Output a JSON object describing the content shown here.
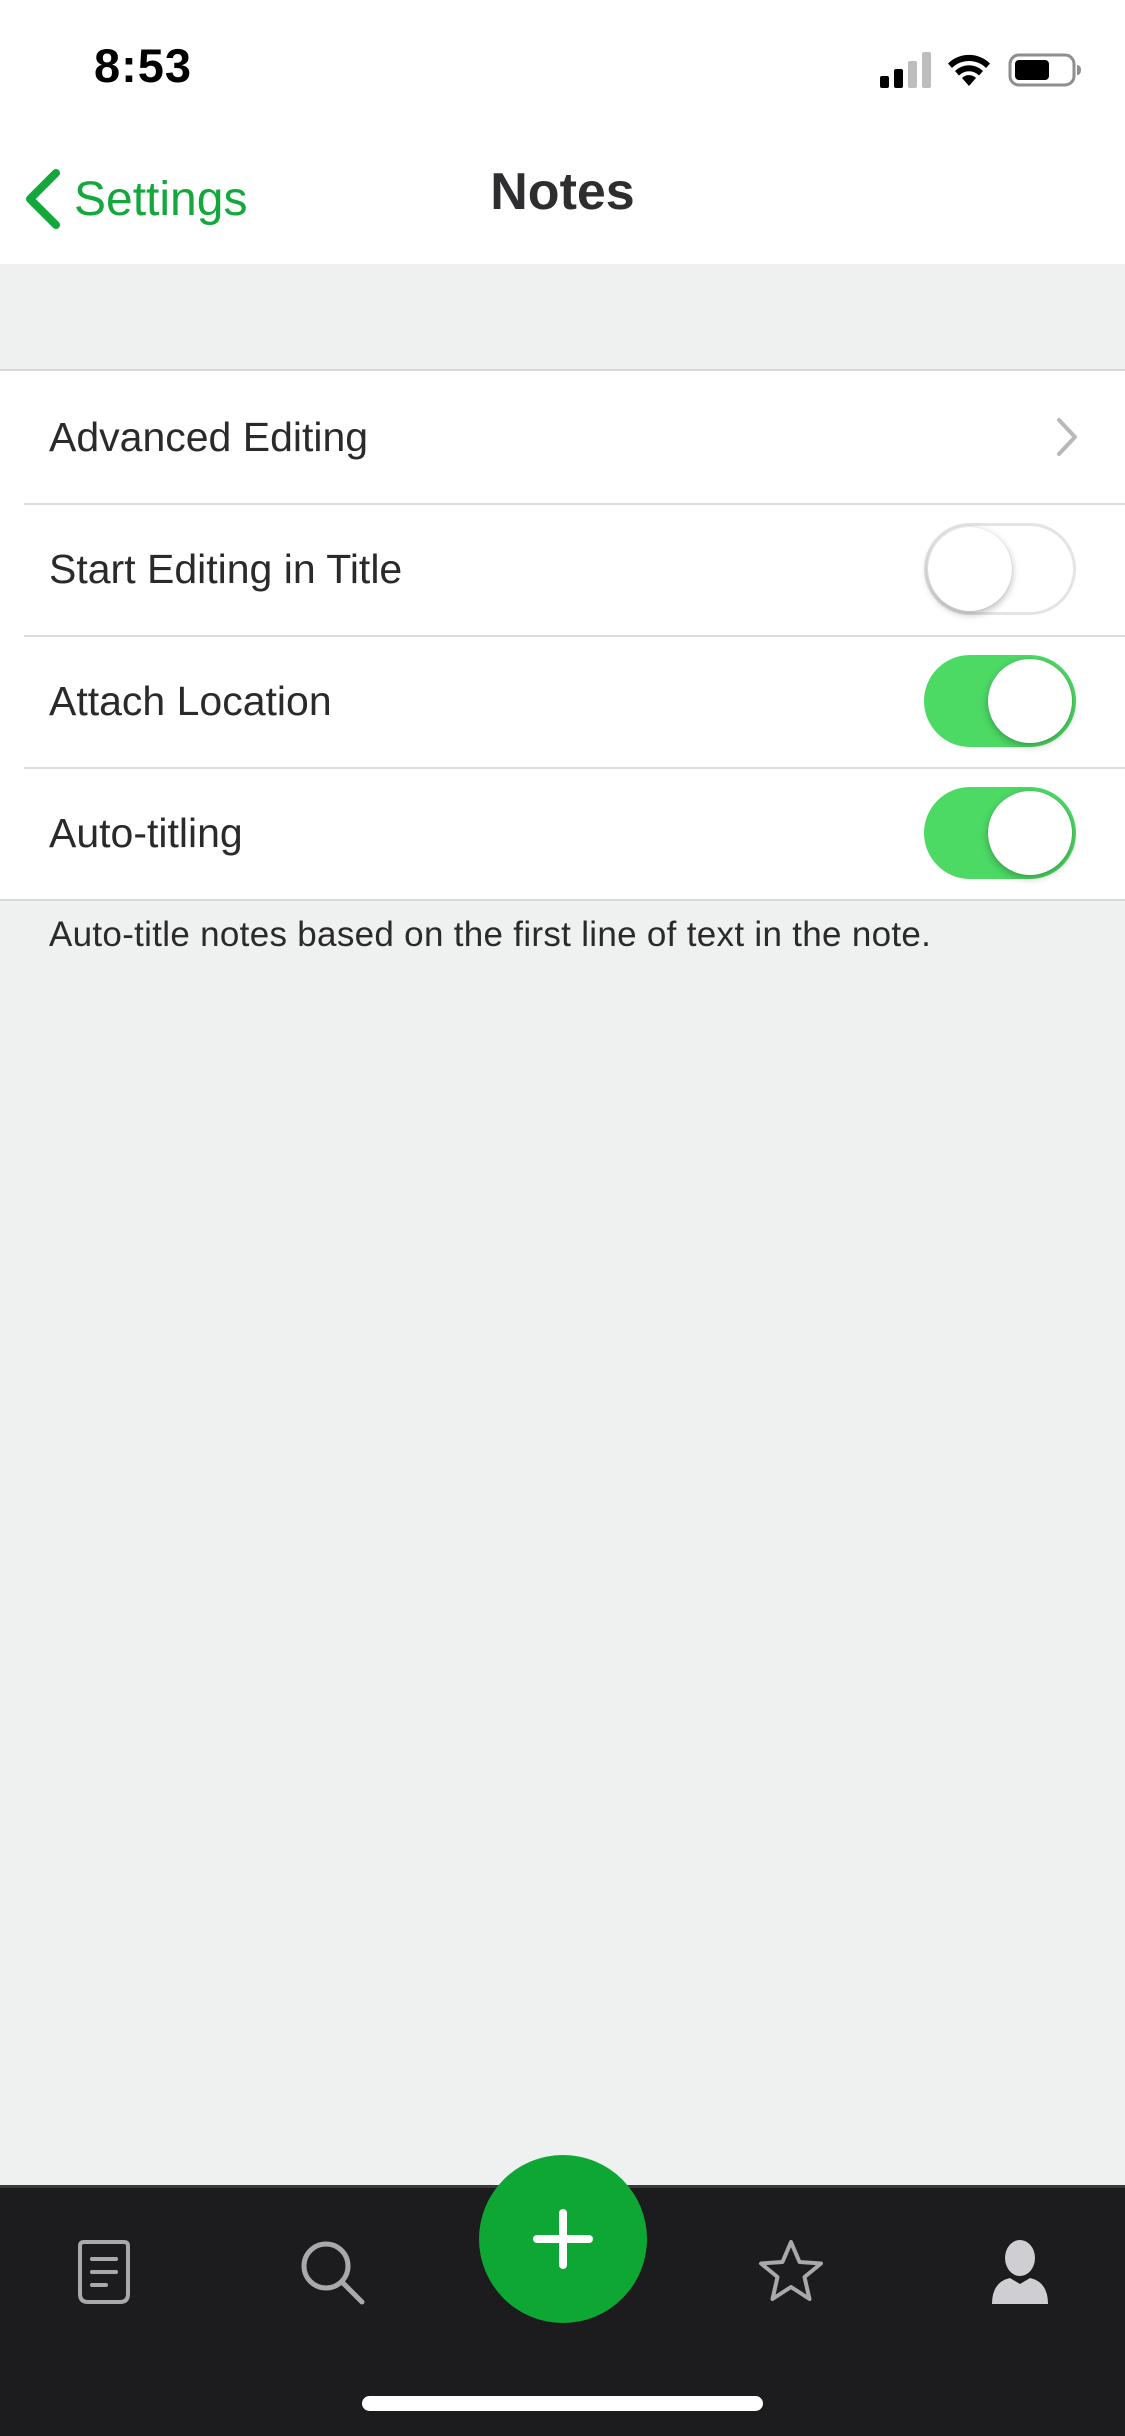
{
  "status_bar": {
    "time": "8:53",
    "icons": [
      "cellular-signal-icon",
      "wifi-icon",
      "battery-icon"
    ]
  },
  "nav": {
    "back_label": "Settings",
    "title": "Notes"
  },
  "settings": {
    "rows": [
      {
        "label": "Advanced Editing",
        "control": "disclosure"
      },
      {
        "label": "Start Editing in Title",
        "control": "toggle",
        "on": false
      },
      {
        "label": "Attach Location",
        "control": "toggle",
        "on": true
      },
      {
        "label": "Auto-titling",
        "control": "toggle",
        "on": true
      }
    ],
    "footer_note": "Auto-title notes based on the first line of text in the note."
  },
  "tab_bar": {
    "items": [
      "notes-icon",
      "search-icon",
      "new-note-plus-icon",
      "shortcuts-star-icon",
      "account-person-icon"
    ]
  },
  "colors": {
    "accent": "#14a83c",
    "toggle_on": "#4cd964",
    "fab": "#0fa734",
    "tab_bar": "#1c1c1e",
    "background": "#eff0f0"
  }
}
